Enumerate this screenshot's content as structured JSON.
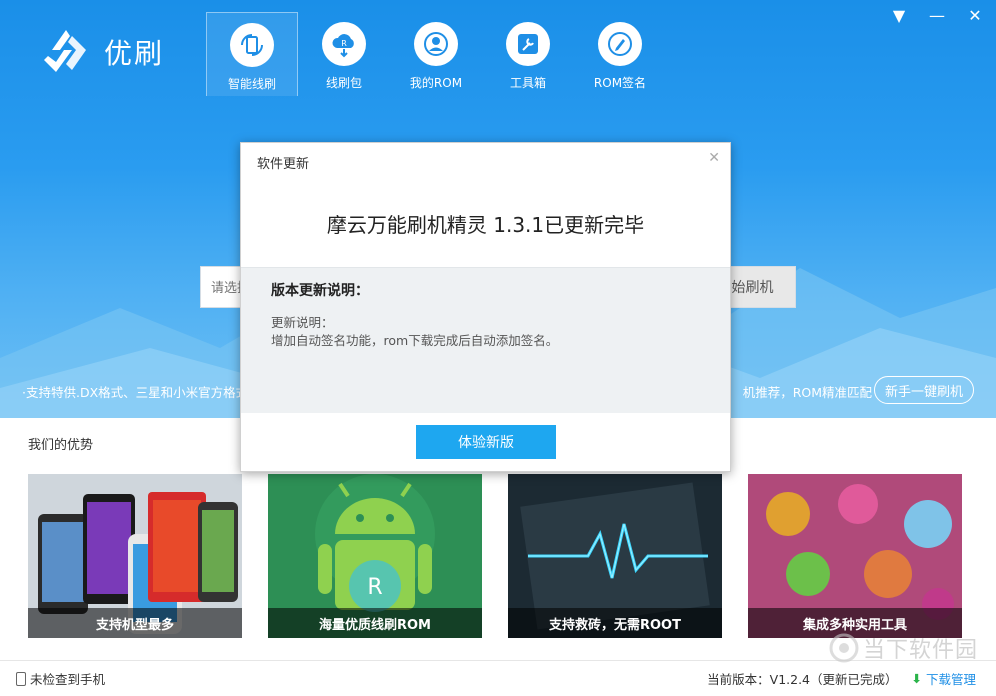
{
  "app": {
    "name": "优刷"
  },
  "window_controls": {
    "menu": "▼",
    "minimize": "—",
    "close": "✕"
  },
  "nav": {
    "items": [
      {
        "label": "智能线刷",
        "icon": "phone-refresh-icon",
        "active": true
      },
      {
        "label": "线刷包",
        "icon": "cloud-download-icon",
        "active": false
      },
      {
        "label": "我的ROM",
        "icon": "user-icon",
        "active": false
      },
      {
        "label": "工具箱",
        "icon": "wrench-icon",
        "active": false
      },
      {
        "label": "ROM签名",
        "icon": "pen-icon",
        "active": false
      }
    ]
  },
  "search": {
    "placeholder": "请选择",
    "button": "开始刷机"
  },
  "hero": {
    "left_tip": "·支持特供.DX格式、三星和小米官方格式",
    "right_tip": "机推荐，ROM精准匹配",
    "guide_button": "新手一键刷机"
  },
  "advantages": {
    "title": "我们的优势",
    "cards": [
      {
        "caption": "支持机型最多"
      },
      {
        "caption": "海量优质线刷ROM"
      },
      {
        "caption": "支持救砖，无需ROOT"
      },
      {
        "caption": "集成多种实用工具"
      }
    ]
  },
  "status": {
    "device": "未检查到手机",
    "version": "当前版本：V1.2.4（更新已完成）",
    "download": "下载管理"
  },
  "watermark": {
    "text": "当下软件园"
  },
  "dialog": {
    "title": "软件更新",
    "close": "✕",
    "headline": "摩云万能刷机精灵 1.3.1已更新完毕",
    "notes_title": "版本更新说明：",
    "notes_sub": "更新说明：",
    "notes_body": "增加自动签名功能，rom下载完成后自动添加签名。",
    "button": "体验新版"
  },
  "colors": {
    "brand": "#1f8fe6",
    "dialog_button": "#1ea7f0"
  }
}
